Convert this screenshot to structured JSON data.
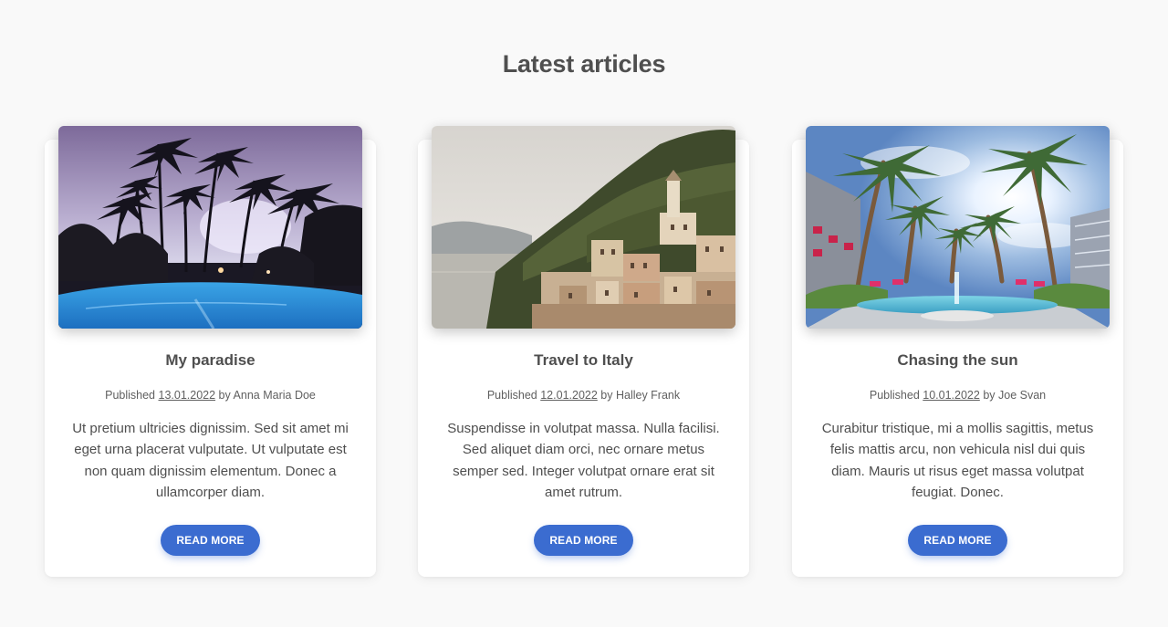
{
  "section": {
    "title": "Latest articles"
  },
  "articles": [
    {
      "title": "My paradise",
      "published_label": "Published",
      "date": "13.01.2022",
      "by_label": "by",
      "author": "Anna Maria Doe",
      "excerpt": "Ut pretium ultricies dignissim. Sed sit amet mi eget urna placerat vulputate. Ut vulputate est non quam dignissim elementum. Donec a ullamcorper diam.",
      "button_label": "READ MORE",
      "image_subject": "palm trees and pool at dusk"
    },
    {
      "title": "Travel to Italy",
      "published_label": "Published",
      "date": "12.01.2022",
      "by_label": "by",
      "author": "Halley Frank",
      "excerpt": "Suspendisse in volutpat massa. Nulla facilisi. Sed aliquet diam orci, nec ornare metus semper sed. Integer volutpat ornare erat sit amet rutrum.",
      "button_label": "READ MORE",
      "image_subject": "coastal Italian village on a green hill"
    },
    {
      "title": "Chasing the sun",
      "published_label": "Published",
      "date": "10.01.2022",
      "by_label": "by",
      "author": "Joe Svan",
      "excerpt": "Curabitur tristique, mi a mollis sagittis, metus felis mattis arcu, non vehicula nisl dui quis diam. Mauris ut risus eget massa volutpat feugiat. Donec.",
      "button_label": "READ MORE",
      "image_subject": "palm trees with sun and fountain"
    }
  ],
  "colors": {
    "background": "#f9f9f9",
    "card": "#ffffff",
    "text": "#4f4f4f",
    "button": "#3b6cd0",
    "button_text": "#ffffff"
  }
}
